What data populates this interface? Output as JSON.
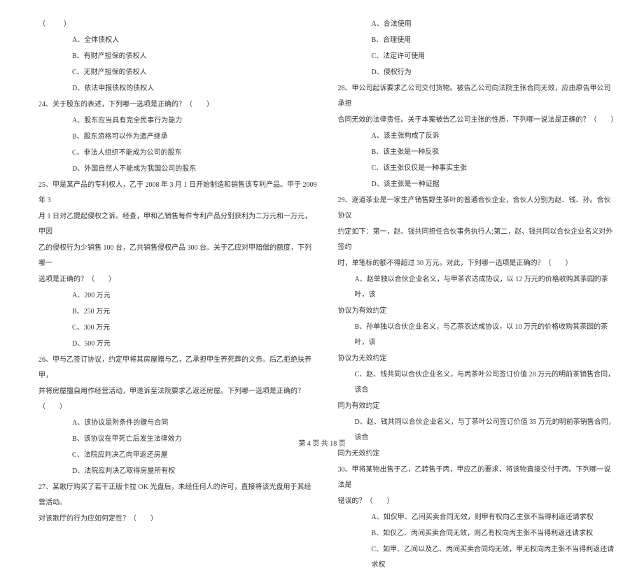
{
  "left": {
    "l1": "（　　）",
    "l2": "A、全体债权人",
    "l3": "B、有财产担保的债权人",
    "l4": "C、无财产担保的债权人",
    "l5": "D、依法申报债权的债权人",
    "q24": "24、关于股东的表述，下列哪一选项是正确的？（　　）",
    "q24a": "A、股东应当具有完全民事行为能力",
    "q24b": "B、股东资格可以作为遗产继承",
    "q24c": "C、非法人组织不能成为公司的股东",
    "q24d": "D、外国自然人不能成为我国公司的股东",
    "q25l1": "25、甲是某产品的专利权人，乙于 2008 年 3 月 1 日开始制造和销售该专利产品。甲于 2009 年 3",
    "q25l2": "月 1 日对乙提起侵权之诉。经查，甲和乙销售每件专利产品分别获利为二万元和一万元，甲因",
    "q25l3": "乙的侵权行为少销售 100 台，乙共销售侵权产品 300 台。关于乙应对甲赔偿的额度，下列哪一",
    "q25l4": "选项是正确的？（　　）",
    "q25a": "A、200 万元",
    "q25b": "B、250 万元",
    "q25c": "C、300 万元",
    "q25d": "D、500 万元",
    "q26l1": "26、甲与乙签订协议，约定甲将其房屋赠与乙，乙承担甲生养死葬的义务。后乙拒绝扶养甲，",
    "q26l2": "并将房屋擅自用作经营活动，甲遂诉至法院要求乙返还房屋。下列哪一选项是正确的？（　　）",
    "q26a": "A、该协议是附条件的赠与合同",
    "q26b": "B、该协议在甲死亡后发生法律效力",
    "q26c": "C、法院应判决乙向甲返还房屋",
    "q26d": "D、法院应判决乙取得房屋所有权",
    "q27l1": "27、某歌厅购买了若干正版卡拉 OK 光盘后，未经任何人的许可，直接将该光盘用于其经营活动。",
    "q27l2": "对该歌厅的行为应如何定性？（　　）"
  },
  "right": {
    "o1": "A、合法使用",
    "o2": "B、合理使用",
    "o3": "C、法定许可使用",
    "o4": "D、侵权行为",
    "q28l1": "28、甲公司起诉要求乙公司交付货物。被告乙公司向法院主张合同无效，应由原告甲公司承担",
    "q28l2": "合同无效的法律责任。关于本案被告乙公司主张的性质，下列哪一说法是正确的？（　　）",
    "q28a": "A、该主张构成了反诉",
    "q28b": "B、该主张是一种反驳",
    "q28c": "C、该主张仅仅是一种事实主张",
    "q28d": "D、该主张是一种证据",
    "q29l1": "29、逐道茶业是一家生产销售野生茶叶的普通合伙企业，合伙人分别为赵、钱、孙。合伙协议",
    "q29l2": "约定如下：第一，赵、钱共同担任合伙事务执行人;第二，赵、钱共同以合伙企业名义对外签约",
    "q29l3": "时，单笔标的额不得超过 30 万元。对此，下列哪一选项是正确的？（　　）",
    "q29al1": "A、赵单独以合伙企业名义，与甲茶农达成协议，以 12 万元的价格收购其茶园的茶叶，该",
    "q29al2": "协议为有效约定",
    "q29bl1": "B、孙单独以合伙企业名义，与乙茶农达成协议，以 10 万元的价格收购其茶园的茶叶，该",
    "q29bl2": "协议为无效约定",
    "q29cl1": "C、赵、钱共同以合伙企业名义，与丙茶叶公司签订价值 28 万元的明前茶销售合同，该合",
    "q29cl2": "同为有效约定",
    "q29dl1": "D、赵、钱共同以合伙企业名义，与丁茶叶公司签订价值 35 万元的明前茶销售合同，该合",
    "q29dl2": "同为无效约定",
    "q30l1": "30、甲将某物出售于乙，乙转售于丙，甲应乙的要求，将该物直接交付于丙。下列哪一说法是",
    "q30l2": "错误的？（　　）",
    "q30a": "A、如仅甲、乙间买卖合同无效，则甲有权向乙主张不当得利返还请求权",
    "q30b": "B、如仅乙、丙间买卖合同无效，则乙有权向丙主张不当得利返还请求权",
    "q30c": "C、如甲、乙间以及乙、丙间买卖合同均无效，甲无权向丙主张不当得利返还请求权"
  },
  "footer": "第 4 页 共 18 页"
}
